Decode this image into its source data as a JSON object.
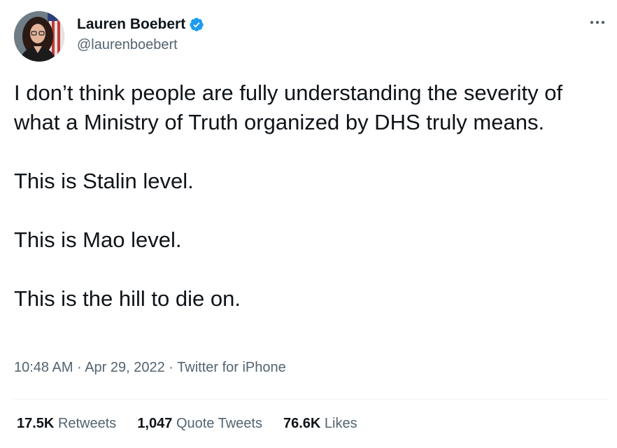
{
  "user": {
    "display_name": "Lauren Boebert",
    "handle": "@laurenboebert",
    "verified_icon": "verified-badge-icon",
    "avatar_icon": "profile-photo"
  },
  "tweet": {
    "paragraphs": [
      "I don’t think people are fully understanding the severity of what a Ministry of Truth organized by DHS truly means.",
      "This is Stalin level.",
      "This is Mao level.",
      "This is the hill to die on."
    ],
    "time": "10:48 AM",
    "separator": " · ",
    "date": "Apr 29, 2022",
    "source": "Twitter for iPhone"
  },
  "stats": {
    "retweets": {
      "count": "17.5K",
      "label": "Retweets"
    },
    "quote_tweets": {
      "count": "1,047",
      "label": "Quote Tweets"
    },
    "likes": {
      "count": "76.6K",
      "label": "Likes"
    }
  },
  "colors": {
    "text_primary": "#0f1419",
    "text_secondary": "#536471",
    "verified": "#1d9bf0",
    "divider": "#eff3f4"
  }
}
